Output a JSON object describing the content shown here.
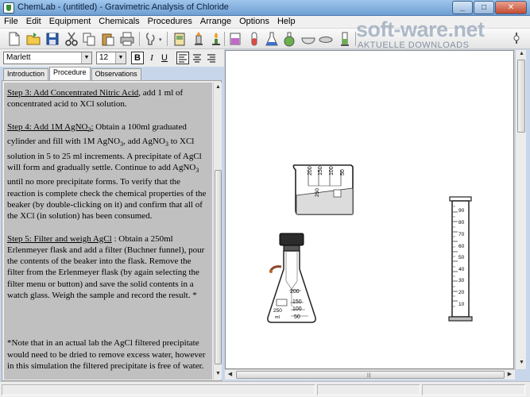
{
  "window": {
    "title": "ChemLab - (untitled) - Gravimetric Analysis of Chloride"
  },
  "menu": [
    "File",
    "Edit",
    "Equipment",
    "Chemicals",
    "Procedures",
    "Arrange",
    "Options",
    "Help"
  ],
  "watermark": {
    "main": "soft-ware.net",
    "sub": "AKTUELLE DOWNLOADS"
  },
  "fontbar": {
    "font": "Marlett",
    "size": "12",
    "bold": "B",
    "italic": "I",
    "underline": "U"
  },
  "tabs": [
    {
      "label": "Introduction",
      "active": false
    },
    {
      "label": "Procedure",
      "active": true
    },
    {
      "label": "Observations",
      "active": false
    }
  ],
  "procedure": {
    "step3_title": "Step 3: Add Concentrated Nitric Acid",
    "step3_body": ", add 1 ml of concentrated acid to XCl solution.",
    "step4_title": "Step 4: Add 1M AgNO",
    "step4_sub": "3",
    "step4_colon": ":",
    "step4_body_a": "  Obtain a 100ml graduated cylinder and fill with 1M AgNO",
    "step4_body_b": ", add AgNO",
    "step4_body_c": " to XCl solution in 5 to 25 ml increments. A precipitate of AgCl will form and gradually settle. Continue to add AgNO",
    "step4_body_d": " until no more precipitate forms. To verify that the reaction is complete check the chemical properties of the beaker (by double-clicking on it) and confirm that all of the XCl (in solution) has been consumed.",
    "step5_title": "Step 5:  Filter and weigh AgCl",
    "step5_body": " : Obtain  a 250ml Erlenmeyer flask and add a filter (Buchner funnel), pour the contents of the beaker into the flask. Remove the filter from the Erlenmeyer flask  (by again selecting the filter menu or button)  and save the solid contents in a watch glass. Weigh the sample and record the result. *",
    "note": "*Note that in an actual lab the AgCl filtered precipitate would need to be dried to remove excess water, however in this simulation the filtered precipitate is free of water."
  },
  "beaker": {
    "ticks": [
      "200",
      "150",
      "100",
      "50"
    ],
    "capacity": "250"
  },
  "flask": {
    "ticks": [
      "200",
      "150",
      "100",
      "50"
    ],
    "capacity": "250",
    "unit": "ml"
  },
  "cylinder": {
    "ticks": [
      "90",
      "80",
      "70",
      "60",
      "50",
      "40",
      "30",
      "20",
      "10"
    ]
  }
}
